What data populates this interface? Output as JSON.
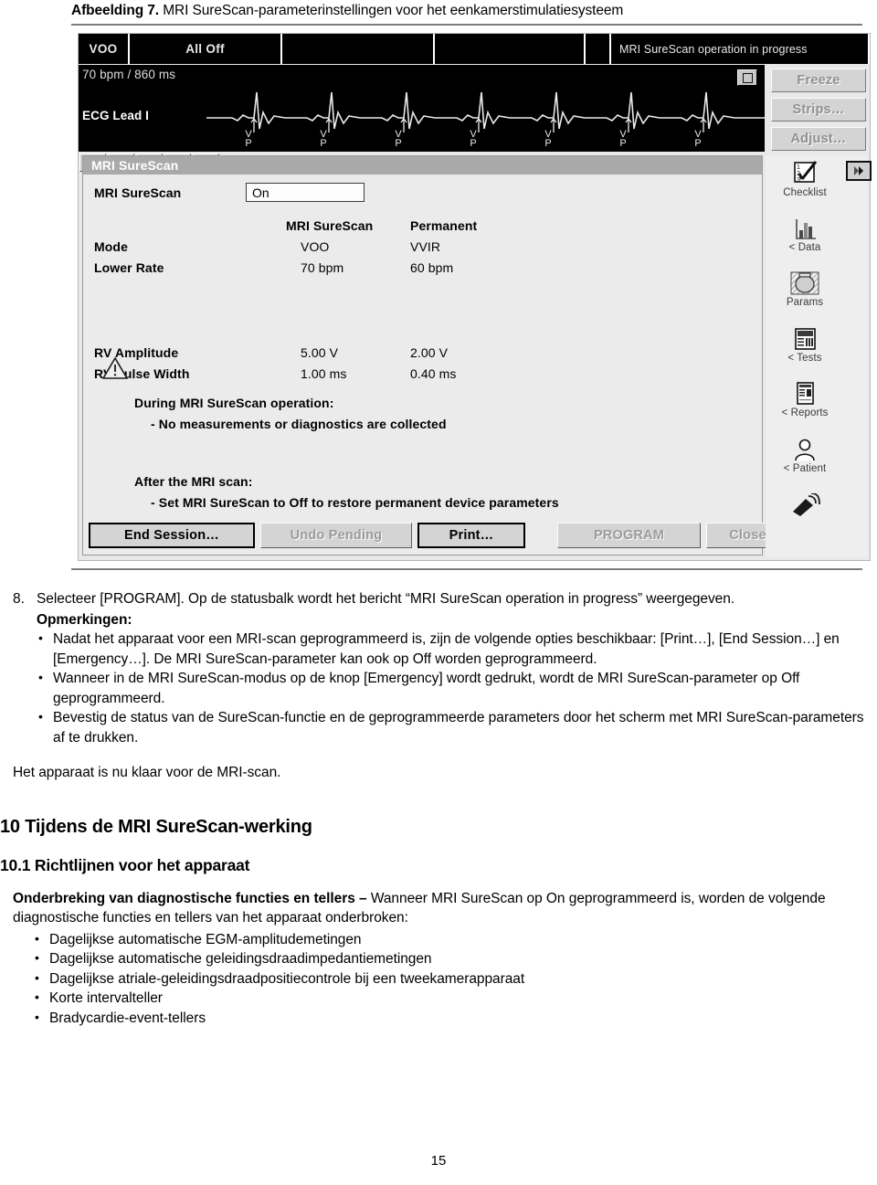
{
  "figure": {
    "label": "Afbeelding 7.",
    "caption": "MRI SureScan-parameterinstellingen voor het eenkamerstimulatiesysteem"
  },
  "device_screen": {
    "status_bar": {
      "segments": [
        "VOO",
        "All Off",
        "",
        "",
        "",
        "MRI SureScan operation in progress"
      ]
    },
    "ecg": {
      "rate": "70 bpm / 860 ms",
      "lead": "ECG Lead I",
      "marker": "V\nP",
      "marker_top": "V",
      "marker_bottom": "P",
      "toolbar": [
        "scroll-up",
        "amplitude",
        "scroll-down",
        "play",
        "display"
      ],
      "maximize": "maximize-icon"
    },
    "ecg_buttons": [
      "Freeze",
      "Strips…",
      "Adjust…"
    ],
    "panel": {
      "title": "MRI SureScan",
      "surescan_label": "MRI SureScan",
      "surescan_value": "On",
      "column_headers": [
        "MRI SureScan",
        "Permanent"
      ],
      "rows": [
        {
          "label": "Mode",
          "surescan": "VOO",
          "permanent": "VVIR"
        },
        {
          "label": "Lower Rate",
          "surescan": "70 bpm",
          "permanent": "60 bpm"
        },
        {
          "label": "RV Amplitude",
          "surescan": "5.00 V",
          "permanent": "2.00 V"
        },
        {
          "label": "RV Pulse Width",
          "surescan": "1.00 ms",
          "permanent": "0.40 ms"
        }
      ],
      "notes": [
        "During MRI SureScan operation:",
        "- No measurements or diagnostics are collected",
        "After the MRI scan:",
        "- Set MRI SureScan to Off to restore permanent device parameters"
      ]
    },
    "actions": [
      {
        "label": "End Session…",
        "state": "enabled"
      },
      {
        "label": "Undo Pending",
        "state": "disabled"
      },
      {
        "label": "Print…",
        "state": "enabled"
      },
      {
        "label": "PROGRAM",
        "state": "disabled"
      },
      {
        "label": "Close",
        "state": "disabled"
      }
    ],
    "rail": [
      {
        "label": "Checklist",
        "icon": "checklist-icon"
      },
      {
        "label": "< Data",
        "icon": "bar-chart-icon"
      },
      {
        "label": "Params",
        "icon": "params-icon"
      },
      {
        "label": "< Tests",
        "icon": "tests-icon"
      },
      {
        "label": "< Reports",
        "icon": "reports-icon"
      },
      {
        "label": "< Patient",
        "icon": "patient-icon"
      },
      {
        "label": "",
        "icon": "wand-icon"
      }
    ],
    "next_button": "next-arrow-icon"
  },
  "body": {
    "step8_num": "8.",
    "step8_text": "Selecteer [PROGRAM]. Op de statusbalk wordt het bericht “MRI SureScan operation in progress” weergegeven.",
    "notes_heading": "Opmerkingen:",
    "notes": [
      "Nadat het apparaat voor een MRI-scan geprogrammeerd is, zijn de volgende opties beschikbaar: [Print…], [End Session…] en [Emergency…]. De MRI SureScan-parameter kan ook op Off worden geprogrammeerd.",
      "Wanneer in de MRI SureScan-modus op de knop [Emergency] wordt gedrukt, wordt de MRI SureScan-parameter op Off geprogrammeerd.",
      "Bevestig de status van de SureScan-functie en de geprogrammeerde parameters door het scherm met MRI SureScan-parameters af te drukken."
    ],
    "ready_text": "Het apparaat is nu klaar voor de MRI-scan.",
    "section_heading": "10  Tijdens de MRI SureScan-werking",
    "subsection_heading": "10.1  Richtlijnen voor het apparaat",
    "lead_bold": "Onderbreking van diagnostische functies en tellers – ",
    "lead_rest": "Wanneer MRI SureScan op On geprogrammeerd is, worden de volgende diagnostische functies en tellers van het apparaat onderbroken:",
    "bullets": [
      "Dagelijkse automatische EGM-amplitudemetingen",
      "Dagelijkse automatische geleidingsdraadimpedantiemetingen",
      "Dagelijkse atriale-geleidingsdraadpositiecontrole bij een tweekamerapparaat",
      "Korte intervalteller",
      "Bradycardie-event-tellers"
    ],
    "page_number": "15"
  }
}
